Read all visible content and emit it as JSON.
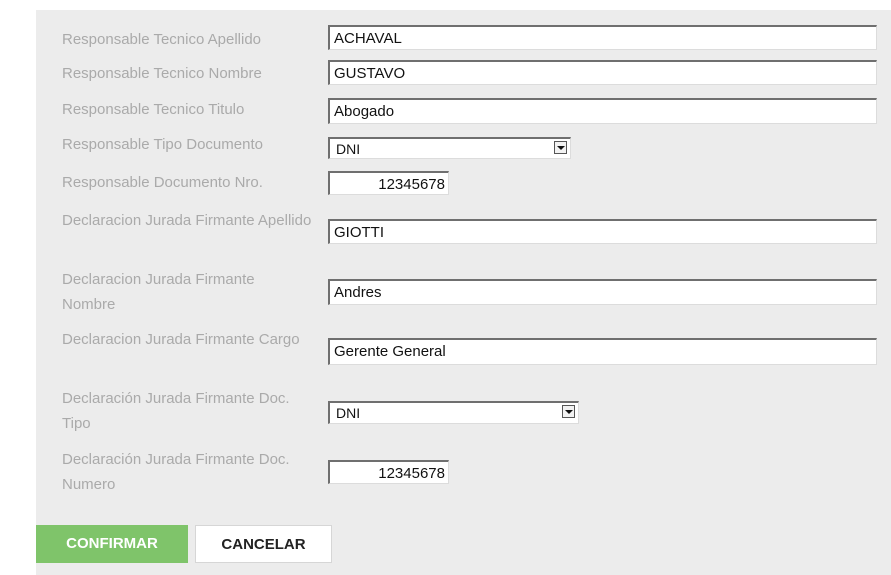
{
  "form": {
    "labels": {
      "tec_apellido": "Responsable Tecnico Apellido",
      "tec_nombre": "Responsable Tecnico Nombre",
      "tec_titulo": "Responsable Tecnico Titulo",
      "tipo_doc": "Responsable Tipo Documento",
      "doc_nro": "Responsable Documento Nro.",
      "dj_apellido": "Declaracion Jurada Firmante Apellido",
      "dj_nombre": "Declaracion Jurada Firmante Nombre",
      "dj_cargo": "Declaracion Jurada Firmante Cargo",
      "dj_doc_tipo": "Declaración Jurada Firmante Doc. Tipo",
      "dj_doc_numero": "Declaración Jurada Firmante Doc. Numero"
    },
    "values": {
      "tec_apellido": "ACHAVAL",
      "tec_nombre": "GUSTAVO",
      "tec_titulo": "Abogado",
      "tipo_doc": "DNI",
      "doc_nro": "12345678",
      "dj_apellido": "GIOTTI",
      "dj_nombre": "Andres",
      "dj_cargo": "Gerente General",
      "dj_doc_tipo": "DNI",
      "dj_doc_numero": "12345678"
    }
  },
  "actions": {
    "confirm_label": "CONFIRMAR",
    "cancel_label": "CANCELAR"
  },
  "colors": {
    "confirm_bg": "#7fc46a",
    "panel_bg": "#ececec",
    "label_text": "#aaaaaa"
  },
  "icons": {
    "select_arrow": "chevron-down-icon"
  }
}
